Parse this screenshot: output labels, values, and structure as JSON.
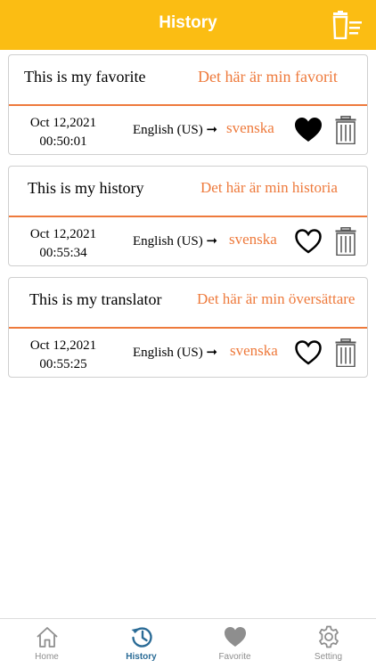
{
  "header": {
    "title": "History"
  },
  "entries": [
    {
      "source": "This is my favorite",
      "translation": "Det här är min favorit",
      "date": "Oct 12,2021",
      "time": "00:50:01",
      "from_lang": "English (US) ➞",
      "to_lang": "svenska",
      "favorited": true
    },
    {
      "source": "This is my history",
      "translation": "Det här är min historia",
      "date": "Oct 12,2021",
      "time": "00:55:34",
      "from_lang": "English (US) ➞",
      "to_lang": "svenska",
      "favorited": false
    },
    {
      "source": "This is my translator",
      "translation": "Det här är min översättare",
      "date": "Oct 12,2021",
      "time": "00:55:25",
      "from_lang": "English (US) ➞",
      "to_lang": "svenska",
      "favorited": false
    }
  ],
  "tabs": [
    {
      "label": "Home",
      "icon": "home-icon"
    },
    {
      "label": "History",
      "icon": "history-icon",
      "active": true
    },
    {
      "label": "Favorite",
      "icon": "heart-icon"
    },
    {
      "label": "Setting",
      "icon": "gear-icon"
    }
  ],
  "colors": {
    "header": "#fbbd13",
    "accent": "#ee7a3c",
    "active_tab": "#2a6b96",
    "inactive_tab": "#8e8e8e"
  }
}
